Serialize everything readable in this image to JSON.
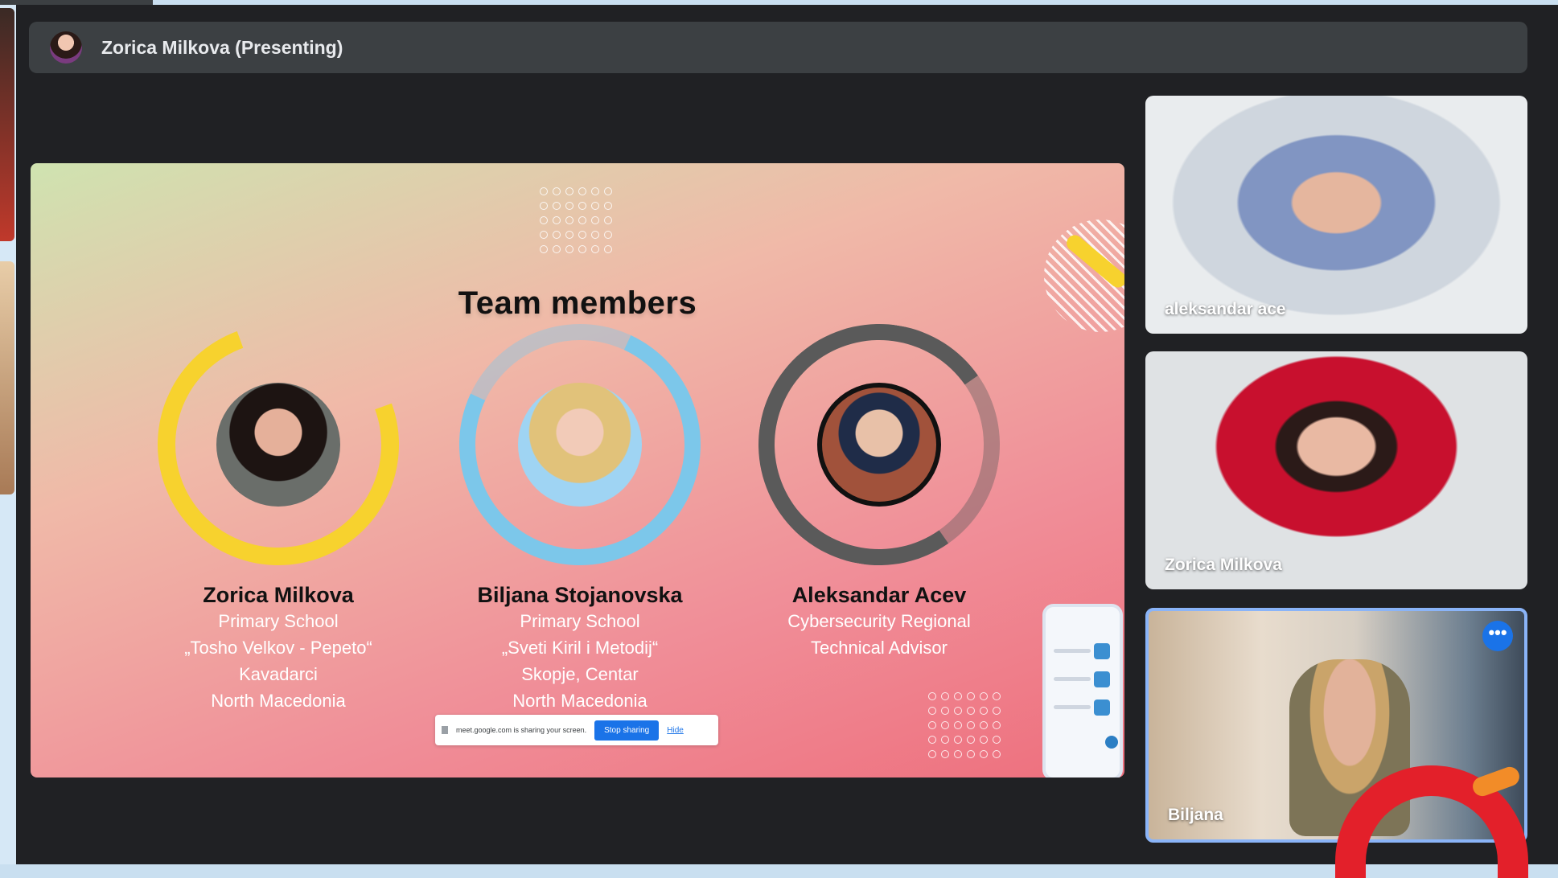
{
  "presenter": {
    "name": "Zorica Milkova (Presenting)"
  },
  "slide": {
    "title": "Team members",
    "members": [
      {
        "name": "Zorica Milkova",
        "lines": [
          "Primary School",
          "„Tosho Velkov - Pepeto“",
          "Kavadarci",
          "North Macedonia"
        ]
      },
      {
        "name": "Biljana Stojanovska",
        "lines": [
          "Primary School",
          "„Sveti Kiril i Metodij“",
          "Skopje, Centar",
          "North Macedonia"
        ]
      },
      {
        "name": "Aleksandar Acev",
        "lines": [
          "Cybersecurity Regional",
          "Technical Advisor"
        ]
      }
    ]
  },
  "share_bar": {
    "message": "meet.google.com is sharing your screen.",
    "stop_label": "Stop sharing",
    "hide_label": "Hide"
  },
  "participants": [
    {
      "name": "aleksandar ace"
    },
    {
      "name": "Zorica Milkova"
    },
    {
      "name": "Biljana",
      "more_label": "•••"
    }
  ],
  "icons": [
    "presenter-avatar",
    "more-options-icon",
    "user-icon"
  ],
  "colors": {
    "accent": "#1a73e8",
    "background": "#202124",
    "bar": "#3c4043"
  }
}
